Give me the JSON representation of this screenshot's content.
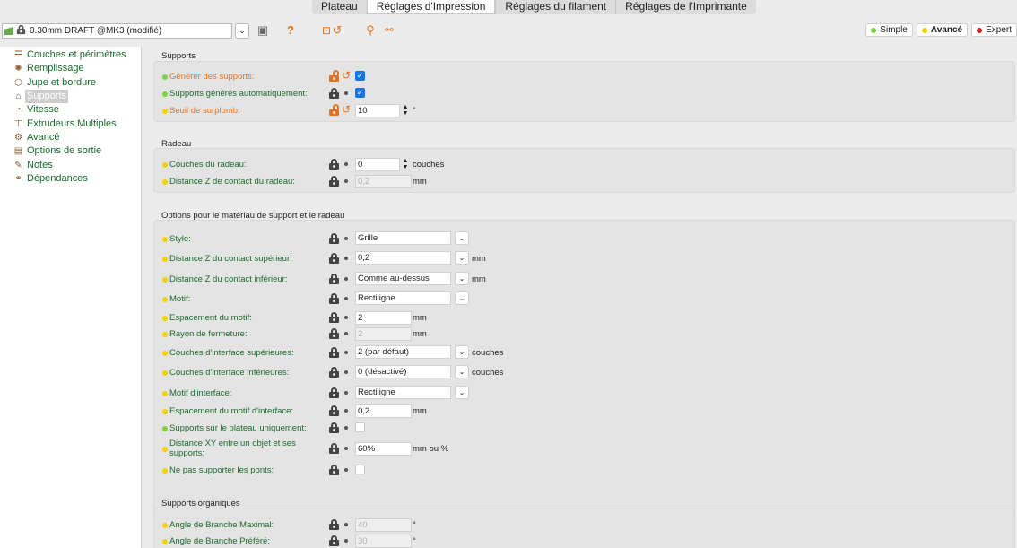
{
  "tabs": [
    "Plateau",
    "Réglages d'Impression",
    "Réglages du filament",
    "Réglages de l'Imprimante"
  ],
  "active_tab": 1,
  "toolbar": {
    "preset": "0.30mm DRAFT @MK3 (modifié)",
    "modes": [
      {
        "label": "Simple",
        "color": "#7cd33a"
      },
      {
        "label": "Avancé",
        "color": "#f5d100"
      },
      {
        "label": "Expert",
        "color": "#d0201a"
      }
    ]
  },
  "sidebar": {
    "items": [
      {
        "label": "Couches et périmètres",
        "icon": "layers-icon"
      },
      {
        "label": "Remplissage",
        "icon": "infill-icon"
      },
      {
        "label": "Jupe et bordure",
        "icon": "skirt-icon"
      },
      {
        "label": "Supports",
        "icon": "support-icon"
      },
      {
        "label": "Vitesse",
        "icon": "speed-icon"
      },
      {
        "label": "Extrudeurs Multiples",
        "icon": "extruder-icon"
      },
      {
        "label": "Avancé",
        "icon": "advanced-icon"
      },
      {
        "label": "Options de sortie",
        "icon": "output-icon"
      },
      {
        "label": "Notes",
        "icon": "notes-icon"
      },
      {
        "label": "Dépendances",
        "icon": "dependencies-icon"
      }
    ],
    "active": 3
  },
  "colors": {
    "simple": "#7cd33a",
    "advanced": "#f5d100",
    "modified": "#e8721c"
  },
  "sections": {
    "supports": {
      "title": "Supports",
      "rows": [
        {
          "label": "Générer des supports:",
          "checked": true
        },
        {
          "label": "Supports générés automatiquement:",
          "checked": true
        },
        {
          "label": "Seuil de surplomb:",
          "value": "10",
          "unit": "°"
        }
      ]
    },
    "raft": {
      "title": "Radeau",
      "rows": [
        {
          "label": "Couches du radeau:",
          "value": "0",
          "unit": "couches"
        },
        {
          "label": "Distance Z de contact du radeau:",
          "value": "0,2",
          "unit": "mm"
        }
      ]
    },
    "options": {
      "title": "Options pour le matériau de support et le radeau",
      "rows": [
        {
          "label": "Style:",
          "value": "Grille",
          "unit": ""
        },
        {
          "label": "Distance Z du contact supérieur:",
          "value": "0,2",
          "unit": "mm"
        },
        {
          "label": "Distance Z du contact inférieur:",
          "value": "Comme au-dessus",
          "unit": "mm"
        },
        {
          "label": "Motif:",
          "value": "Rectiligne",
          "unit": ""
        },
        {
          "label": "Espacement du motif:",
          "value": "2",
          "unit": "mm"
        },
        {
          "label": "Rayon de fermeture:",
          "value": "2",
          "unit": "mm"
        },
        {
          "label": "Couches d'interface supérieures:",
          "value": "2 (par défaut)",
          "unit": "couches"
        },
        {
          "label": "Couches d'interface inférieures:",
          "value": "0 (désactivé)",
          "unit": "couches"
        },
        {
          "label": "Motif d'interface:",
          "value": "Rectiligne",
          "unit": ""
        },
        {
          "label": "Espacement du motif d'interface:",
          "value": "0,2",
          "unit": "mm"
        },
        {
          "label": "Supports sur le plateau uniquement:",
          "checked": false
        },
        {
          "label": "Distance XY entre un objet et ses supports:",
          "value": "60%",
          "unit": "mm ou %"
        },
        {
          "label": "Ne pas supporter les ponts:",
          "checked": false
        }
      ]
    },
    "organic": {
      "title": "Supports organiques",
      "rows": [
        {
          "label": "Angle de Branche Maximal:",
          "value": "40",
          "unit": "°"
        },
        {
          "label": "Angle de Branche Préféré:",
          "value": "30",
          "unit": "°"
        }
      ]
    }
  }
}
